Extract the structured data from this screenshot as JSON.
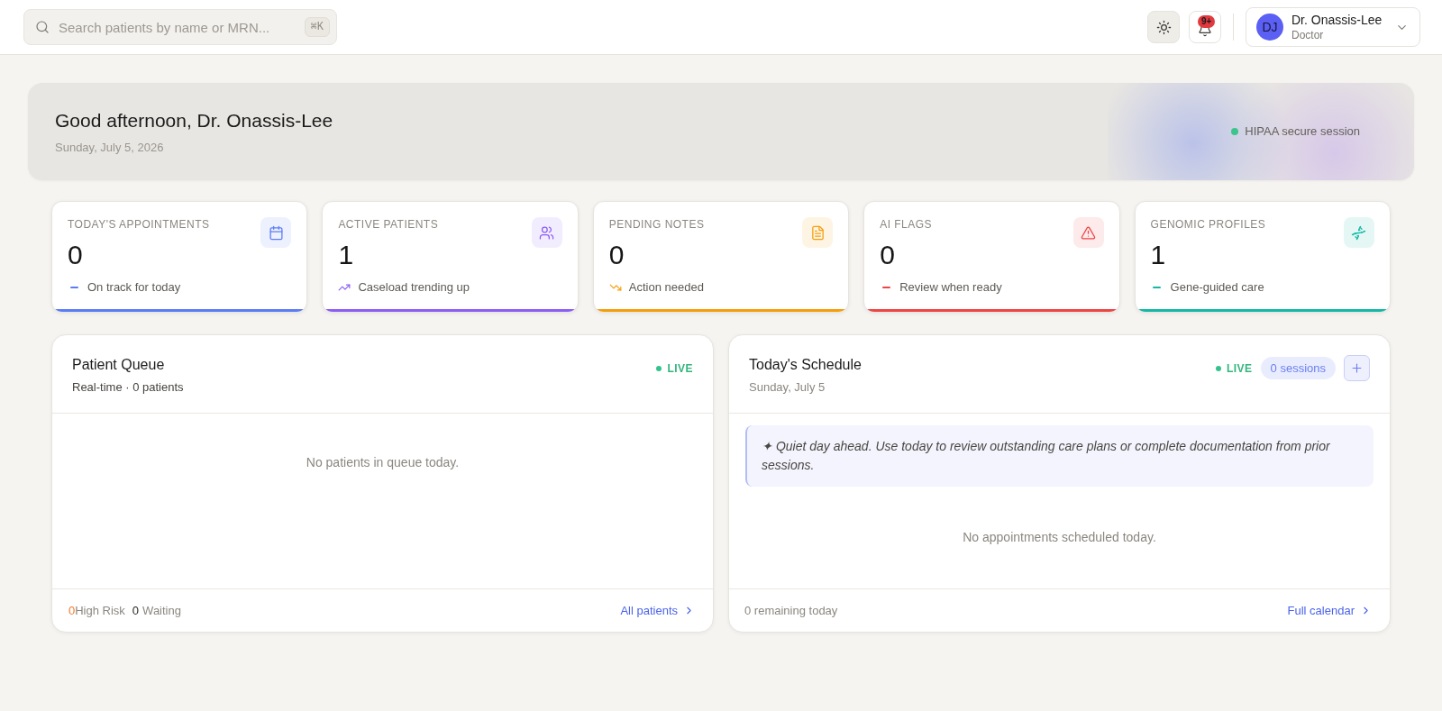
{
  "search": {
    "placeholder": "Search patients by name or MRN...",
    "shortcut": "⌘K"
  },
  "notifications": {
    "badge": "9+"
  },
  "user": {
    "initials": "DJ",
    "name": "Dr. Onassis-Lee",
    "role": "Doctor"
  },
  "greeting": {
    "title": "Good afternoon, Dr. Onassis-Lee",
    "date": "Sunday, July 5, 2026",
    "session_status": "HIPAA secure session"
  },
  "stats": [
    {
      "label": "TODAY'S APPOINTMENTS",
      "value": "0",
      "kind": "flat",
      "note": "On track for today",
      "color": "#5b7cf6"
    },
    {
      "label": "ACTIVE PATIENTS",
      "value": "1",
      "kind": "up",
      "note": "Caseload trending up",
      "color": "#8b5cf6"
    },
    {
      "label": "PENDING NOTES",
      "value": "0",
      "kind": "down",
      "note": "Action needed",
      "color": "#f59e0b"
    },
    {
      "label": "AI FLAGS",
      "value": "0",
      "kind": "flat",
      "note": "Review when ready",
      "color": "#ef4444"
    },
    {
      "label": "GENOMIC PROFILES",
      "value": "1",
      "kind": "flat",
      "note": "Gene-guided care",
      "color": "#14b8a6"
    }
  ],
  "patient_queue": {
    "title": "Patient Queue",
    "subtitle": "Real-time · 0 patients",
    "live": "LIVE",
    "empty_message": "No patients in queue today.",
    "footer": {
      "high_risk_count": "0",
      "high_risk_label": "High Risk",
      "waiting_count": "0",
      "waiting_label": "Waiting",
      "link": "All patients"
    }
  },
  "schedule": {
    "title": "Today's Schedule",
    "subtitle": "Sunday, July 5",
    "live": "LIVE",
    "sessions": "0 sessions",
    "tip": "✦ Quiet day ahead. Use today to review outstanding care plans or complete documentation from prior sessions.",
    "empty_message": "No appointments scheduled today.",
    "footer": {
      "remaining": "0 remaining today",
      "link": "Full calendar"
    }
  }
}
